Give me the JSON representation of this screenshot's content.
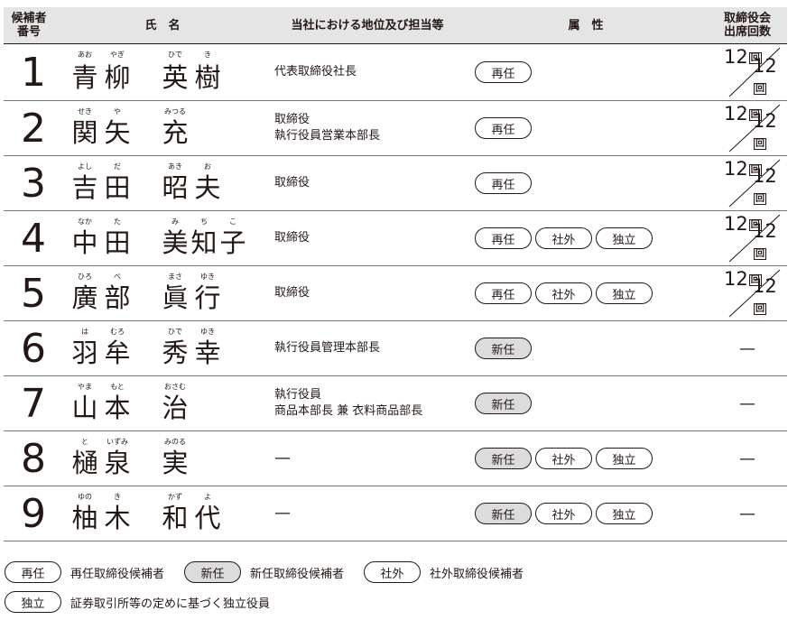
{
  "header": {
    "no": "候補者\n番号",
    "name": "氏　名",
    "position": "当社における地位及び担当等",
    "attributes": "属　性",
    "attendance": "取締役会\n出席回数"
  },
  "badges": {
    "reappointed": "再任",
    "new": "新任",
    "outside": "社外",
    "independent": "独立"
  },
  "candidates": [
    {
      "no": "1",
      "kanji": [
        "青",
        "柳",
        "英",
        "樹"
      ],
      "furigana": [
        "あお",
        "やぎ",
        "ひで",
        "き"
      ],
      "position": [
        "代表取締役社長"
      ],
      "attrs": [
        "再任"
      ],
      "attendance": {
        "attended": "12",
        "total": "12",
        "unit": "回"
      }
    },
    {
      "no": "2",
      "kanji": [
        "関",
        "矢",
        "充"
      ],
      "furigana": [
        "せき",
        "や",
        "みつる"
      ],
      "position": [
        "取締役",
        "執行役員営業本部長"
      ],
      "attrs": [
        "再任"
      ],
      "attendance": {
        "attended": "12",
        "total": "12",
        "unit": "回"
      }
    },
    {
      "no": "3",
      "kanji": [
        "吉",
        "田",
        "昭",
        "夫"
      ],
      "furigana": [
        "よし",
        "だ",
        "あき",
        "お"
      ],
      "position": [
        "取締役"
      ],
      "attrs": [
        "再任"
      ],
      "attendance": {
        "attended": "12",
        "total": "12",
        "unit": "回"
      }
    },
    {
      "no": "4",
      "kanji": [
        "中",
        "田",
        "美",
        "知",
        "子"
      ],
      "furigana": [
        "なか",
        "た",
        "み",
        "ち",
        "こ"
      ],
      "position": [
        "取締役"
      ],
      "attrs": [
        "再任",
        "社外",
        "独立"
      ],
      "attendance": {
        "attended": "12",
        "total": "12",
        "unit": "回"
      }
    },
    {
      "no": "5",
      "kanji": [
        "廣",
        "部",
        "眞",
        "行"
      ],
      "furigana": [
        "ひろ",
        "べ",
        "まさ",
        "ゆき"
      ],
      "position": [
        "取締役"
      ],
      "attrs": [
        "再任",
        "社外",
        "独立"
      ],
      "attendance": {
        "attended": "12",
        "total": "12",
        "unit": "回"
      }
    },
    {
      "no": "6",
      "kanji": [
        "羽",
        "牟",
        "秀",
        "幸"
      ],
      "furigana": [
        "は",
        "むろ",
        "ひで",
        "ゆき"
      ],
      "position": [
        "執行役員管理本部長"
      ],
      "attrs": [
        "新任"
      ],
      "attendance": null
    },
    {
      "no": "7",
      "kanji": [
        "山",
        "本",
        "治"
      ],
      "furigana": [
        "やま",
        "もと",
        "おさむ"
      ],
      "position": [
        "執行役員",
        "商品本部長 兼 衣料商品部長"
      ],
      "attrs": [
        "新任"
      ],
      "attendance": null
    },
    {
      "no": "8",
      "kanji": [
        "樋",
        "泉",
        "実"
      ],
      "furigana": [
        "と",
        "いずみ",
        "みのる"
      ],
      "position": [
        "—"
      ],
      "attrs": [
        "新任",
        "社外",
        "独立"
      ],
      "attendance": null
    },
    {
      "no": "9",
      "kanji": [
        "柚",
        "木",
        "和",
        "代"
      ],
      "furigana": [
        "ゆの",
        "き",
        "かず",
        "よ"
      ],
      "position": [
        "—"
      ],
      "attrs": [
        "新任",
        "社外",
        "独立"
      ],
      "attendance": null
    }
  ],
  "dash": "—",
  "legend": [
    {
      "badge": "再任",
      "text": "再任取締役候補者"
    },
    {
      "badge": "新任",
      "text": "新任取締役候補者"
    },
    {
      "badge": "社外",
      "text": "社外取締役候補者"
    },
    {
      "badge": "独立",
      "text": "証券取引所等の定めに基づく独立役員"
    }
  ]
}
